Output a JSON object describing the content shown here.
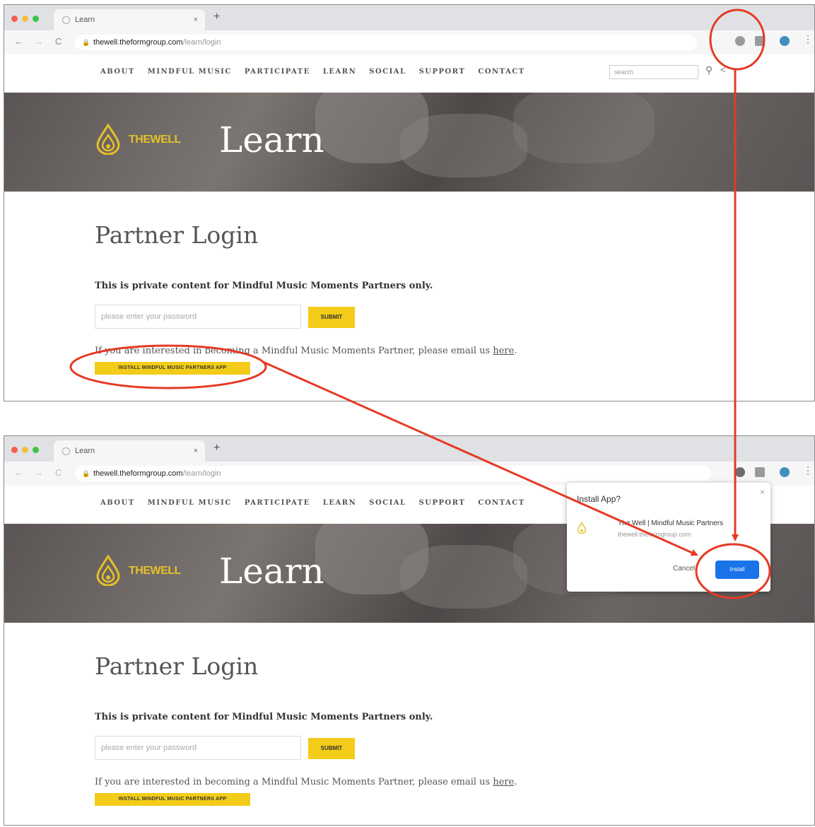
{
  "browser": {
    "tab_title": "Learn",
    "tab_close": "×",
    "new_tab": "+",
    "url_host": "thewell.theformgroup.com",
    "url_path": "/learn/login",
    "lock": "🔒",
    "back": "←",
    "forward": "→",
    "reload": "C",
    "menu": "⋮"
  },
  "site": {
    "nav_items": [
      "ABOUT",
      "MINDFUL MUSIC",
      "PARTICIPATE",
      "LEARN",
      "SOCIAL",
      "SUPPORT",
      "CONTACT"
    ],
    "search_placeholder": "search",
    "brand": "THEWELL",
    "hero_title": "Learn"
  },
  "content": {
    "page_title": "Partner Login",
    "intro": "This is private content for Mindful Music Moments Partners only.",
    "password_placeholder": "please enter your password",
    "submit_label": "SUBMIT",
    "interest_prefix": "If you are interested in becoming a Mindful Music Moments Partner, please email us ",
    "interest_link": "here",
    "interest_suffix": ".",
    "install_label": "INSTALL MINDFUL MUSIC PARTNERS APP"
  },
  "install_dialog": {
    "title": "Install App?",
    "close": "×",
    "app_name": "The Well | Mindful Music Partners",
    "app_url": "thewell.theformgroup.com",
    "cancel_label": "Cancel",
    "install_label": "Install"
  },
  "colors": {
    "accent_yellow": "#f2cc18",
    "annotation_red": "#e53a24",
    "install_blue": "#1a73e8"
  }
}
